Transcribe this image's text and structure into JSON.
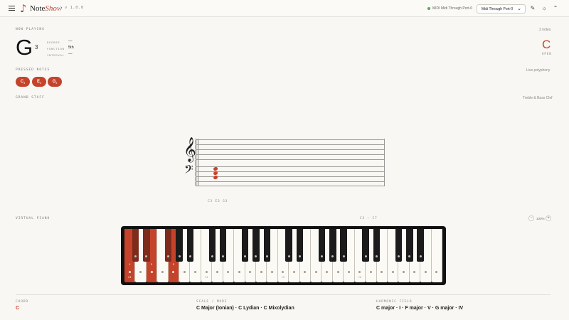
{
  "header": {
    "logo_mark": "♪",
    "logo_name_a": "Note",
    "logo_name_b": "Show",
    "version": "v 1.0.0",
    "midi_status": "MIDI Midi Through Port-0",
    "midi_device": "Midi Through Port-0",
    "icons": [
      "menu-icon",
      "pencil-icon",
      "sun-icon",
      "chevron-up-icon"
    ],
    "status_color": "#4caf50"
  },
  "now_playing": {
    "label": "NOW PLAYING",
    "note": "G",
    "octave": "3",
    "degree_key": "DEGREE",
    "degree_val": "—",
    "function_key": "FUNCTION",
    "function_val": "5th",
    "interval_key": "INTERVAL",
    "interval_val": "—",
    "count": "3 notes",
    "open_letter": "C",
    "open_label": "OPEN"
  },
  "pressed": {
    "label": "PRESSED NOTES",
    "mode": "Live polyphony",
    "notes": [
      {
        "name": "C",
        "octave": "3"
      },
      {
        "name": "E",
        "octave": "3"
      },
      {
        "name": "G",
        "octave": "3"
      }
    ]
  },
  "staff": {
    "label": "GRAND STAFF",
    "clefs": "Treble & Bass Clef",
    "treble_glyph": "𝄞",
    "bass_glyph": "𝄢",
    "caption": "C3  E3  G3"
  },
  "piano": {
    "label": "VIRTUAL PIANO",
    "range": "C3 – C7",
    "zoom_out": "−",
    "zoom_in": "+",
    "zoom": "100%",
    "c_labels": [
      "C3",
      "C4",
      "C5",
      "C6"
    ],
    "pressed_marks": [
      "1",
      "3",
      "5"
    ],
    "pressed_names": [
      "C3",
      "E3",
      "G3"
    ]
  },
  "bottom": {
    "chord_label": "CHORD",
    "chord_val": "C",
    "scale_label": "SCALE / MODE",
    "scale_val": "C Major (Ionian) · C Lydian · C Mixolydian",
    "field_label": "HARMONIC FIELD",
    "field_val": "C major · I · F major · V · G major · IV"
  },
  "colors": {
    "accent": "#c5432a",
    "background": "#f8f7f3"
  }
}
